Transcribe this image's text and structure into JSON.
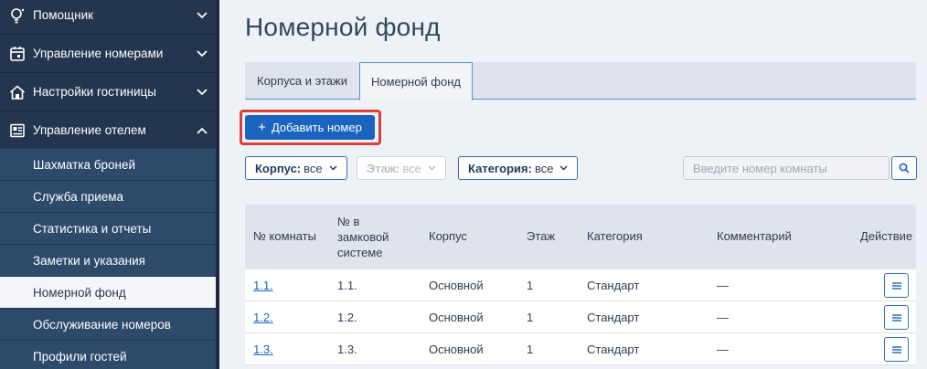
{
  "sidebar": {
    "items": [
      {
        "label": "Помощник",
        "icon": "lightbulb-icon"
      },
      {
        "label": "Управление номерами",
        "icon": "calendar-icon"
      },
      {
        "label": "Настройки гостиницы",
        "icon": "house-icon"
      },
      {
        "label": "Управление отелем",
        "icon": "dashboard-icon"
      }
    ],
    "subitems": [
      {
        "label": "Шахматка броней"
      },
      {
        "label": "Служба приема"
      },
      {
        "label": "Статистика и отчеты"
      },
      {
        "label": "Заметки и указания"
      },
      {
        "label": "Номерной фонд",
        "active": true
      },
      {
        "label": "Обслуживание номеров"
      },
      {
        "label": "Профили гостей"
      }
    ]
  },
  "page": {
    "title": "Номерной фонд"
  },
  "tabs": [
    {
      "label": "Корпуса и этажи"
    },
    {
      "label": "Номерной фонд",
      "active": true
    }
  ],
  "add_button": {
    "label": "Добавить номер"
  },
  "filters": {
    "building": {
      "label": "Корпус:",
      "value": "все"
    },
    "floor": {
      "label": "Этаж:",
      "value": "все"
    },
    "category": {
      "label": "Категория:",
      "value": "все"
    }
  },
  "search": {
    "placeholder": "Введите номер комнаты"
  },
  "table": {
    "headers": {
      "room": "№ комнаты",
      "lock_1": "№ в",
      "lock_2": "замковой",
      "lock_3": "системе",
      "building": "Корпус",
      "floor": "Этаж",
      "category": "Категория",
      "comment": "Комментарий",
      "action": "Действие"
    },
    "rows": [
      {
        "room": "1.1.",
        "lock": "1.1.",
        "building": "Основной",
        "floor": "1",
        "category": "Стандарт",
        "comment": "—"
      },
      {
        "room": "1.2.",
        "lock": "1.2.",
        "building": "Основной",
        "floor": "1",
        "category": "Стандарт",
        "comment": "—"
      },
      {
        "room": "1.3.",
        "lock": "1.3.",
        "building": "Основной",
        "floor": "1",
        "category": "Стандарт",
        "comment": "—"
      }
    ]
  },
  "colors": {
    "sidebar_bg": "#24364f",
    "submenu_bg": "#2e4a6b",
    "primary": "#1a64c0",
    "highlight": "#d9403a"
  }
}
